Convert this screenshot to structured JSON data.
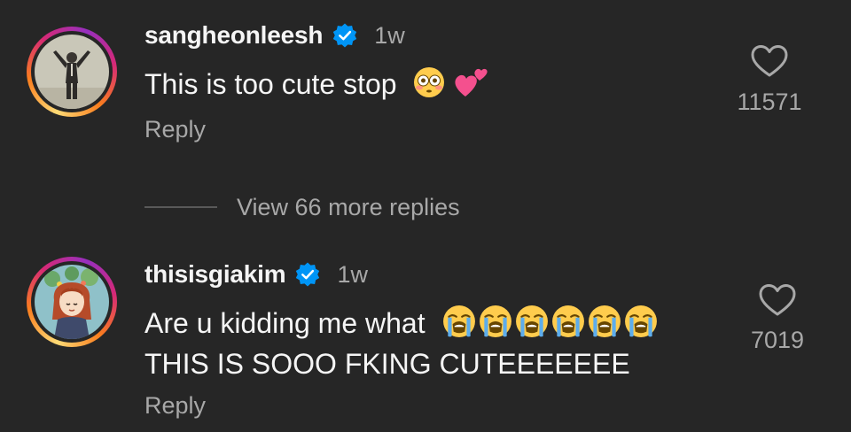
{
  "comments": [
    {
      "username": "sangheonleesh",
      "verified": true,
      "time": "1w",
      "text_lines": [
        "This is too cute stop"
      ],
      "emojis": [
        "flushed-face",
        "two-hearts"
      ],
      "reply_label": "Reply",
      "likes": "11571"
    },
    {
      "username": "thisisgiakim",
      "verified": true,
      "time": "1w",
      "text_lines": [
        "Are u kidding me what",
        "THIS IS SOOO FKING CUTEEEEEEE"
      ],
      "emojis": [
        "loudly-crying-face",
        "loudly-crying-face",
        "loudly-crying-face",
        "loudly-crying-face",
        "loudly-crying-face",
        "loudly-crying-face"
      ],
      "reply_label": "Reply",
      "likes": "7019"
    }
  ],
  "view_more_replies": "View 66 more replies",
  "colors": {
    "background": "#262626",
    "primary_text": "#f5f5f5",
    "secondary_text": "#a8a8a8",
    "verified_blue": "#0095f6"
  }
}
